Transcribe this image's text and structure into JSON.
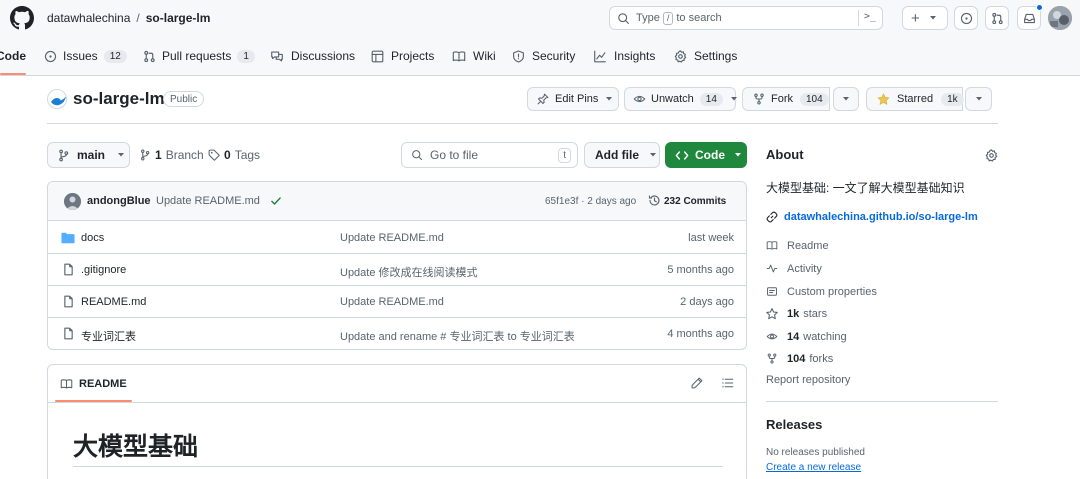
{
  "header": {
    "owner": "datawhalechina",
    "separator": "/",
    "repo": "so-large-lm",
    "search_prefix": "Type",
    "search_key": "/",
    "search_suffix": "to search",
    "command_glyph": ">_",
    "plus_glyph": "+"
  },
  "nav": {
    "tabs": [
      {
        "label": "Code"
      },
      {
        "label": "Issues",
        "count": "12"
      },
      {
        "label": "Pull requests",
        "count": "1"
      },
      {
        "label": "Discussions"
      },
      {
        "label": "Projects"
      },
      {
        "label": "Wiki"
      },
      {
        "label": "Security"
      },
      {
        "label": "Insights"
      },
      {
        "label": "Settings"
      }
    ]
  },
  "repo": {
    "name": "so-large-lm",
    "visibility": "Public",
    "edit_pins": "Edit Pins",
    "unwatch": "Unwatch",
    "watch_count": "14",
    "fork": "Fork",
    "fork_count": "104",
    "starred": "Starred",
    "star_count": "1k"
  },
  "toolbar": {
    "branch": "main",
    "branches_count": "1",
    "branches_label": "Branch",
    "tags_count": "0",
    "tags_label": "Tags",
    "goto_placeholder": "Go to file",
    "goto_key": "t",
    "add_file": "Add file",
    "code": "Code"
  },
  "commit": {
    "author": "andongBlue",
    "message": "Update README.md",
    "meta": "65f1e3f · 2 days ago",
    "commits": "232 Commits"
  },
  "files": [
    {
      "icon": "folder",
      "name": "docs",
      "message": "Update README.md",
      "time": "last week"
    },
    {
      "icon": "file",
      "name": ".gitignore",
      "message": "Update 修改成在线阅读模式",
      "time": "5 months ago"
    },
    {
      "icon": "file",
      "name": "README.md",
      "message": "Update README.md",
      "time": "2 days ago"
    },
    {
      "icon": "file",
      "name": "专业词汇表",
      "message": "Update and rename # 专业词汇表 to 专业词汇表",
      "time": "4 months ago"
    }
  ],
  "readme": {
    "tab": "README",
    "heading": "大模型基础"
  },
  "about": {
    "title": "About",
    "description": "大模型基础: 一文了解大模型基础知识",
    "link": "datawhalechina.github.io/so-large-lm",
    "readme": "Readme",
    "activity": "Activity",
    "custom_properties": "Custom properties",
    "stars_count": "1k",
    "stars_label": "stars",
    "watching_count": "14",
    "watching_label": "watching",
    "forks_count": "104",
    "forks_label": "forks",
    "report": "Report repository"
  },
  "releases": {
    "title": "Releases",
    "none": "No releases published",
    "create": "Create a new release"
  },
  "colors": {
    "accent_blue": "#0969da",
    "code_button_green": "#1f883d",
    "star_yellow": "#eac54f",
    "tab_underline": "#fd8c73",
    "folder_blue": "#54aeff"
  }
}
